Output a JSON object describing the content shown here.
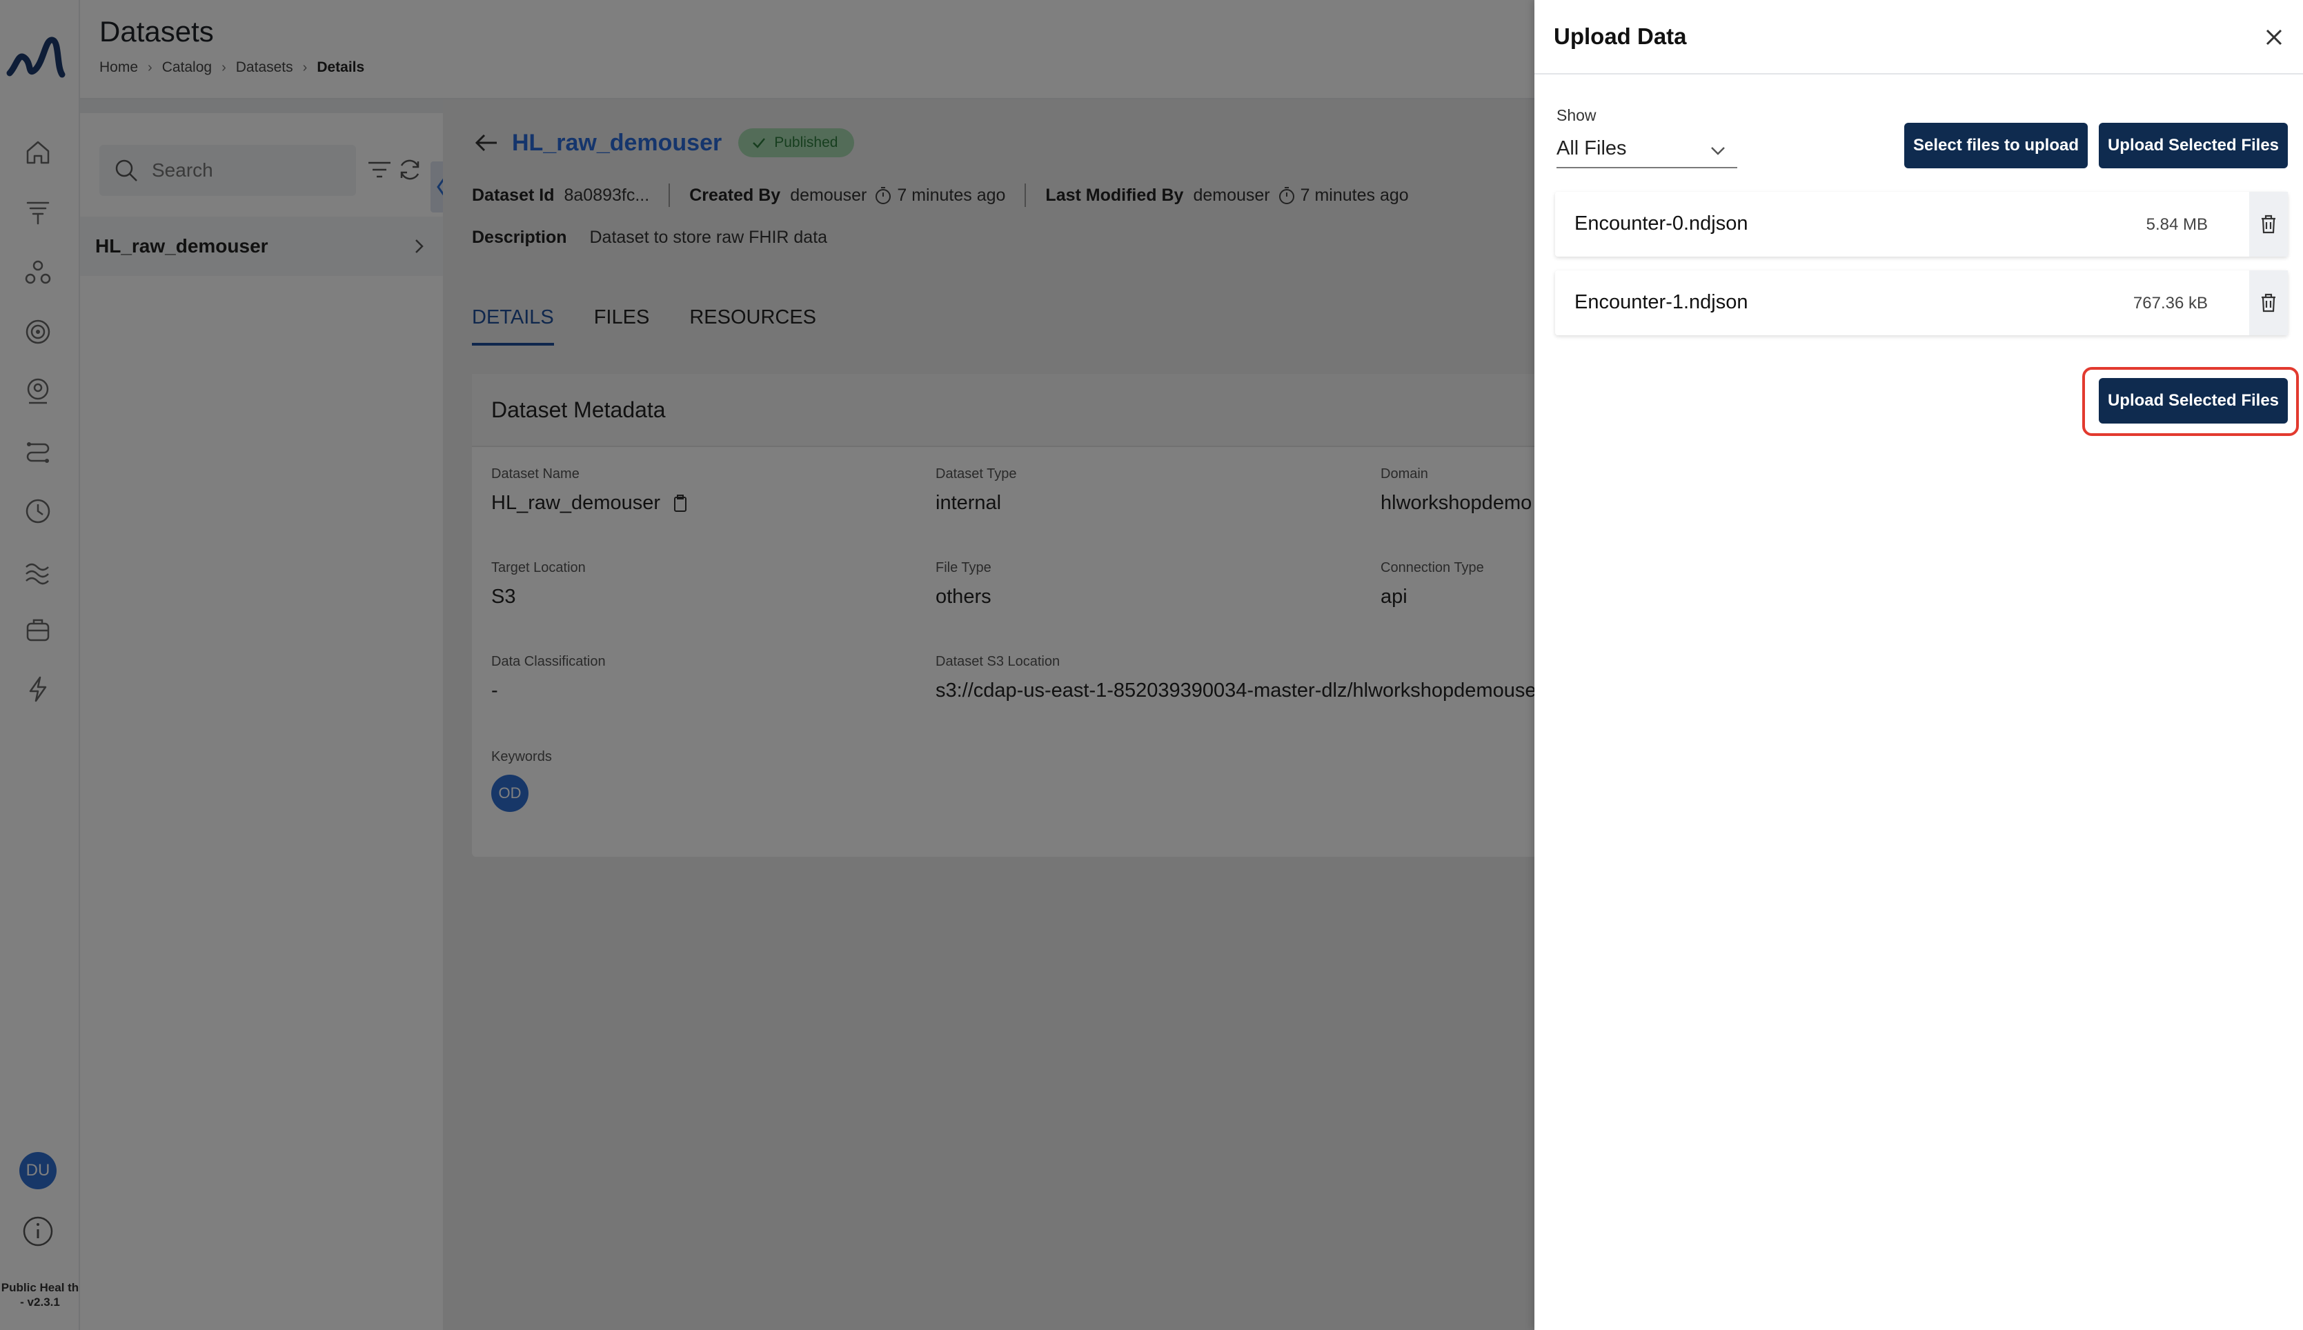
{
  "app": {
    "title": "Datasets",
    "version": "Public Heal th - v2.3.1",
    "user_initials": "DU"
  },
  "breadcrumb": [
    "Home",
    "Catalog",
    "Datasets",
    "Details"
  ],
  "rail_icons": [
    "home-icon",
    "funnel-icon",
    "molecule-icon",
    "target-icon",
    "profile-icon",
    "route-icon",
    "clock-icon",
    "wave-icon",
    "suitcase-icon",
    "lightning-icon"
  ],
  "left_panel": {
    "search_placeholder": "Search",
    "items": [
      {
        "label": "HL_raw_demouser"
      }
    ]
  },
  "dataset": {
    "name": "HL_raw_demouser",
    "status": "Published",
    "id_label": "Dataset Id",
    "id_value": "8a0893fc...",
    "created_by_label": "Created By",
    "created_by": "demouser",
    "created_ago": "7 minutes ago",
    "modified_by_label": "Last Modified By",
    "modified_by": "demouser",
    "modified_ago": "7 minutes ago",
    "description_label": "Description",
    "description": "Dataset to store raw FHIR data"
  },
  "tabs": [
    {
      "label": "DETAILS",
      "active": true
    },
    {
      "label": "FILES",
      "active": false
    },
    {
      "label": "RESOURCES",
      "active": false
    }
  ],
  "metadata": {
    "title": "Dataset Metadata",
    "fields": {
      "dataset_name": {
        "label": "Dataset Name",
        "value": "HL_raw_demouser"
      },
      "dataset_type": {
        "label": "Dataset Type",
        "value": "internal"
      },
      "domain": {
        "label": "Domain",
        "value": "hlworkshopdemo"
      },
      "target_location": {
        "label": "Target Location",
        "value": "S3"
      },
      "file_type": {
        "label": "File Type",
        "value": "others"
      },
      "connection_type": {
        "label": "Connection Type",
        "value": "api"
      },
      "data_classification": {
        "label": "Data Classification",
        "value": "-"
      },
      "s3_location": {
        "label": "Dataset S3 Location",
        "value": "s3://cdap-us-east-1-852039390034-master-dlz/hlworkshopdemouse"
      },
      "keywords": {
        "label": "Keywords",
        "value": "OD"
      }
    }
  },
  "upload_drawer": {
    "title": "Upload Data",
    "show_label": "Show",
    "show_value": "All Files",
    "select_button": "Select files to upload",
    "upload_button": "Upload Selected Files",
    "files": [
      {
        "name": "Encounter-0.ndjson",
        "size": "5.84 MB"
      },
      {
        "name": "Encounter-1.ndjson",
        "size": "767.36 kB"
      }
    ]
  },
  "colors": {
    "primary_button": "#0f2b4f",
    "link": "#2a6ad8",
    "highlight": "#e23a2f",
    "published_badge": "#a6d9b0"
  }
}
